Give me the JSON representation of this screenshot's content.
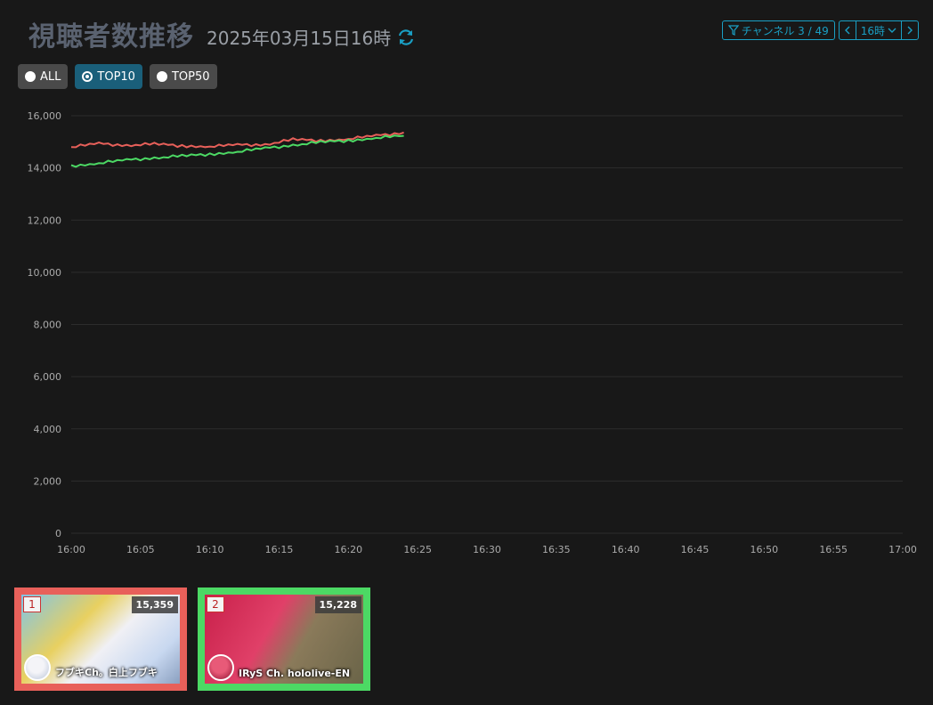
{
  "header": {
    "title": "視聴者数推移",
    "datetime": "2025年03月15日16時"
  },
  "toolbar": {
    "channel_filter_label": "チャンネル 3 / 49",
    "hour_label": "16時"
  },
  "filters": [
    {
      "label": "ALL",
      "active": false
    },
    {
      "label": "TOP10",
      "active": true
    },
    {
      "label": "TOP50",
      "active": false
    }
  ],
  "colors": {
    "accent": "#1a9fc4",
    "series1": "#e8605a",
    "series2": "#4cd964"
  },
  "chart_data": {
    "type": "line",
    "x_ticks": [
      "16:00",
      "16:05",
      "16:10",
      "16:15",
      "16:20",
      "16:25",
      "16:30",
      "16:35",
      "16:40",
      "16:45",
      "16:50",
      "16:55",
      "17:00"
    ],
    "y_ticks": [
      "0",
      "2,000",
      "4,000",
      "6,000",
      "8,000",
      "10,000",
      "12,000",
      "14,000",
      "16,000"
    ],
    "ylim": [
      0,
      16000
    ],
    "xlim_minutes": [
      0,
      60
    ],
    "series": [
      {
        "name": "フブキCh。白上フブキ",
        "color": "#e8605a",
        "points": [
          [
            0,
            14800
          ],
          [
            2,
            14930
          ],
          [
            4,
            14870
          ],
          [
            6,
            14910
          ],
          [
            8,
            14850
          ],
          [
            10,
            14820
          ],
          [
            12,
            14880
          ],
          [
            14,
            14900
          ],
          [
            16,
            15080
          ],
          [
            18,
            15050
          ],
          [
            20,
            15110
          ],
          [
            22,
            15230
          ],
          [
            24,
            15359
          ]
        ]
      },
      {
        "name": "IRyS Ch. hololive-EN",
        "color": "#4cd964",
        "points": [
          [
            0,
            14080
          ],
          [
            2,
            14180
          ],
          [
            4,
            14300
          ],
          [
            6,
            14390
          ],
          [
            8,
            14450
          ],
          [
            10,
            14530
          ],
          [
            12,
            14620
          ],
          [
            14,
            14750
          ],
          [
            16,
            14880
          ],
          [
            18,
            14980
          ],
          [
            20,
            15050
          ],
          [
            22,
            15150
          ],
          [
            24,
            15228
          ]
        ]
      }
    ]
  },
  "cards": [
    {
      "rank": "1",
      "viewers": "15,359",
      "channel": "フブキCh。白上フブキ",
      "border": "#e8605a"
    },
    {
      "rank": "2",
      "viewers": "15,228",
      "channel": "IRyS Ch. hololive-EN",
      "border": "#4cd964"
    }
  ]
}
